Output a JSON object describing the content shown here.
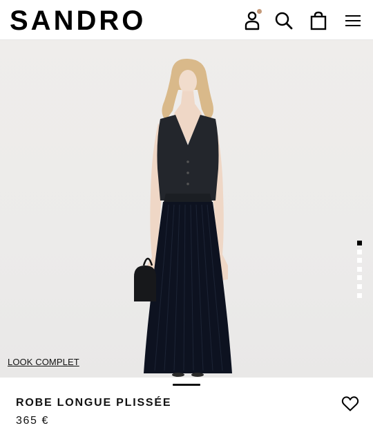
{
  "header": {
    "logo": "SANDRO",
    "icons": [
      "account-icon",
      "search-icon",
      "shopping-bag-icon",
      "menu-icon"
    ],
    "notification_color": "#c49a7a"
  },
  "gallery": {
    "look_link": "LOOK COMPLET",
    "image_count": 7,
    "active_image": 1,
    "background": "#eeedeb"
  },
  "product": {
    "name": "ROBE LONGUE PLISSÉE",
    "price": "365 €",
    "wishlist_icon": "heart-icon"
  }
}
